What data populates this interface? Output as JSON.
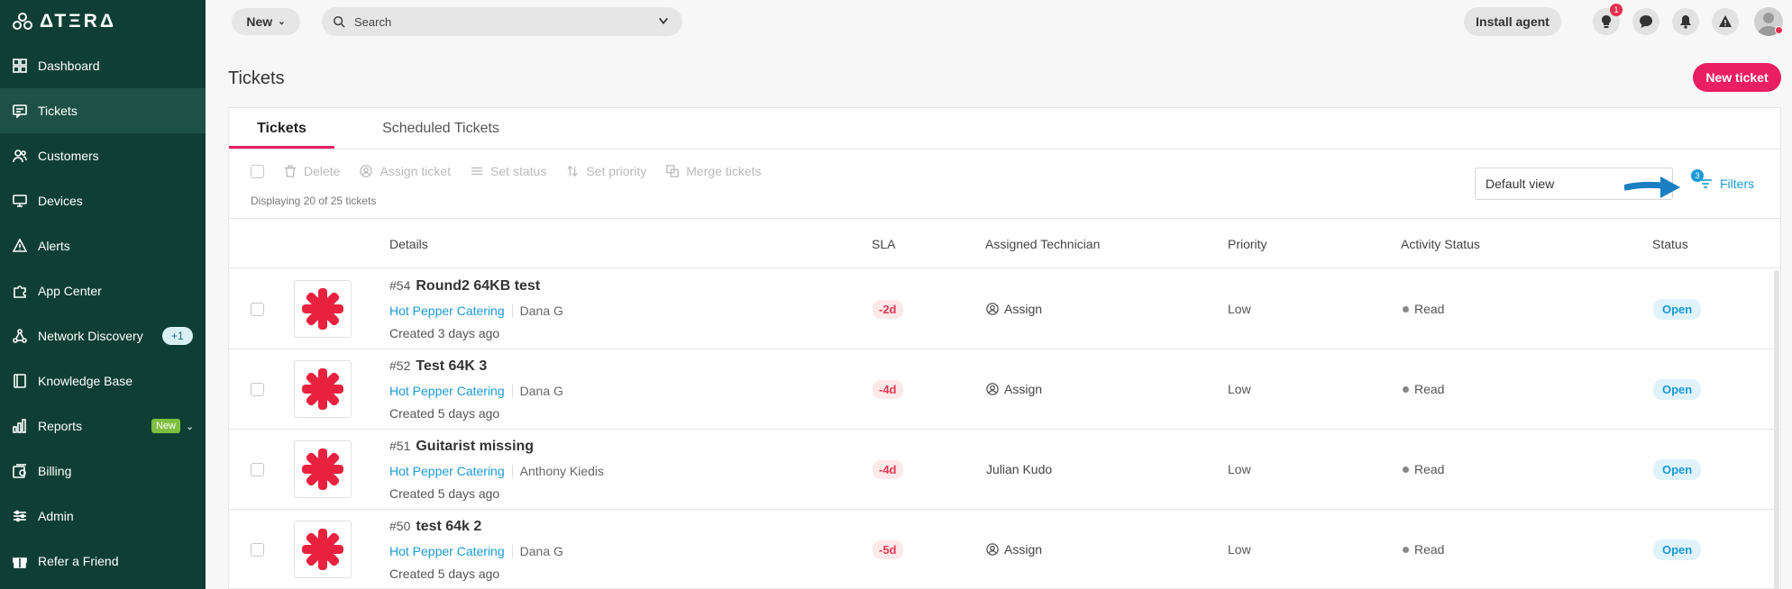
{
  "app": {
    "logo_text": "ΔΤΞRΔ"
  },
  "sidebar": {
    "items": [
      {
        "label": "Dashboard",
        "icon": "grid-icon"
      },
      {
        "label": "Tickets",
        "icon": "ticket-icon",
        "active": true
      },
      {
        "label": "Customers",
        "icon": "users-icon"
      },
      {
        "label": "Devices",
        "icon": "monitor-icon"
      },
      {
        "label": "Alerts",
        "icon": "warning-icon"
      },
      {
        "label": "App Center",
        "icon": "puzzle-icon"
      },
      {
        "label": "Network Discovery",
        "icon": "network-icon",
        "badge": "+1"
      },
      {
        "label": "Knowledge Base",
        "icon": "book-icon"
      },
      {
        "label": "Reports",
        "icon": "chart-icon",
        "badge": "New"
      },
      {
        "label": "Billing",
        "icon": "billing-icon"
      },
      {
        "label": "Admin",
        "icon": "sliders-icon"
      },
      {
        "label": "Refer a Friend",
        "icon": "gift-icon"
      }
    ]
  },
  "topbar": {
    "new_label": "New",
    "search_placeholder": "Search",
    "install_label": "Install agent",
    "lightbulb_badge": "1"
  },
  "page": {
    "title": "Tickets",
    "new_ticket_label": "New ticket"
  },
  "tabs": [
    {
      "label": "Tickets",
      "active": true
    },
    {
      "label": "Scheduled Tickets"
    }
  ],
  "toolbar": {
    "delete": "Delete",
    "assign": "Assign ticket",
    "set_status": "Set status",
    "set_priority": "Set priority",
    "merge": "Merge tickets",
    "displaying": "Displaying 20 of 25 tickets",
    "view": "Default view",
    "filters": "Filters",
    "filter_count": "3"
  },
  "columns": [
    "Details",
    "SLA",
    "Assigned Technician",
    "Priority",
    "Activity Status",
    "Status"
  ],
  "tickets": [
    {
      "num": "#54",
      "title": "Round2 64KB test",
      "customer": "Hot Pepper Catering",
      "contact": "Dana G",
      "created": "Created 3 days ago",
      "sla": "-2d",
      "technician": "Assign",
      "priority": "Low",
      "activity": "Read",
      "status": "Open"
    },
    {
      "num": "#52",
      "title": "Test 64K 3",
      "customer": "Hot Pepper Catering",
      "contact": "Dana G",
      "created": "Created 5 days ago",
      "sla": "-4d",
      "technician": "Assign",
      "priority": "Low",
      "activity": "Read",
      "status": "Open"
    },
    {
      "num": "#51",
      "title": "Guitarist missing",
      "customer": "Hot Pepper Catering",
      "contact": "Anthony Kiedis",
      "created": "Created 5 days ago",
      "sla": "-4d",
      "technician": "Julian Kudo",
      "priority": "Low",
      "activity": "Read",
      "status": "Open"
    },
    {
      "num": "#50",
      "title": "test 64k 2",
      "customer": "Hot Pepper Catering",
      "contact": "Dana G",
      "created": "Created 5 days ago",
      "sla": "-5d",
      "technician": "Assign",
      "priority": "Low",
      "activity": "Read",
      "status": "Open"
    }
  ]
}
